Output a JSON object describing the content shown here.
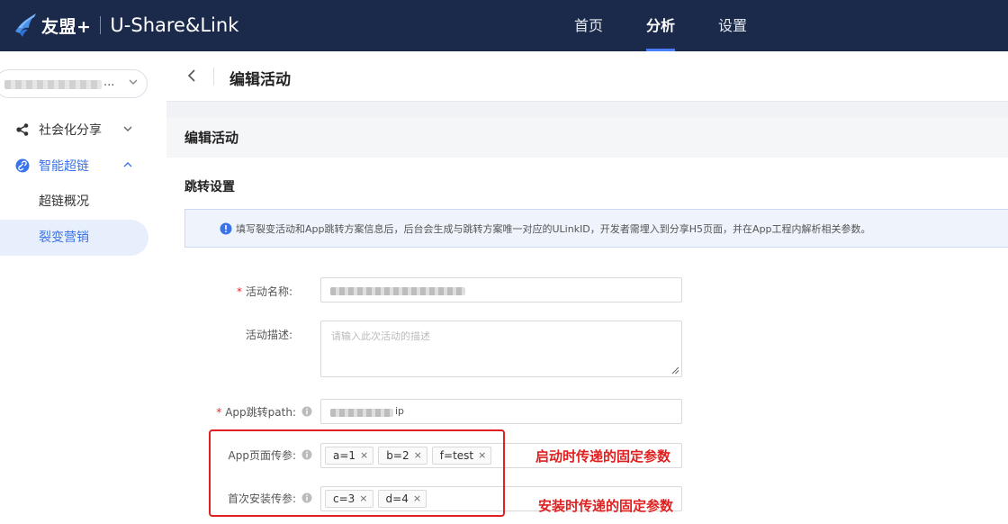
{
  "header": {
    "brand_name": "友盟+",
    "brand_sub": "U-Share&Link",
    "nav": [
      {
        "label": "首页",
        "active": false
      },
      {
        "label": "分析",
        "active": true
      },
      {
        "label": "设置",
        "active": false
      }
    ]
  },
  "sidebar": {
    "app_select": {
      "value_suffix": "..."
    },
    "menu": [
      {
        "label": "社会化分享",
        "icon": "share-icon",
        "expanded": false
      },
      {
        "label": "智能超链",
        "icon": "link-icon",
        "expanded": true
      }
    ],
    "sub_items": [
      {
        "label": "超链概况",
        "active": false
      },
      {
        "label": "裂变营销",
        "active": true
      }
    ]
  },
  "page": {
    "title": "编辑活动",
    "card_title": "编辑活动",
    "section_title": "跳转设置",
    "notice": "填写裂变活动和App跳转方案信息后，后台会生成与跳转方案唯一对应的ULinkID，开发者需埋入到分享H5页面，并在App工程内解析相关参数。"
  },
  "form": {
    "name_label": "活动名称:",
    "desc_label": "活动描述:",
    "desc_placeholder": "请输入此次活动的描述",
    "path_label": "App跳转path:",
    "path_value_suffix": "ip",
    "page_params_label": "App页面传参:",
    "page_params": [
      "a=1",
      "b=2",
      "f=test"
    ],
    "install_params_label": "首次安装传参:",
    "install_params": [
      "c=3",
      "d=4"
    ],
    "tag_close": "×"
  },
  "annotations": {
    "launch": "启动时传递的固定参数",
    "install": "安装时传递的固定参数"
  },
  "colors": {
    "topbar": "#1b2a4a",
    "accent": "#3b73e8",
    "annotation": "#e02020"
  }
}
